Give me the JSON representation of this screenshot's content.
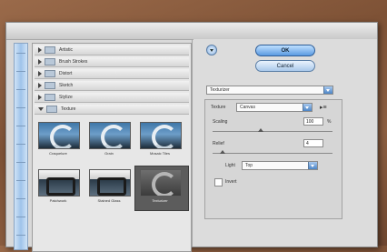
{
  "categories": [
    {
      "label": "Artistic",
      "open": false
    },
    {
      "label": "Brush Strokes",
      "open": false
    },
    {
      "label": "Distort",
      "open": false
    },
    {
      "label": "Sketch",
      "open": false
    },
    {
      "label": "Stylize",
      "open": false
    },
    {
      "label": "Texture",
      "open": true
    }
  ],
  "thumbnails": [
    {
      "label": "Craquelure",
      "style": "blue"
    },
    {
      "label": "Grain",
      "style": "blue"
    },
    {
      "label": "Mosaic Tiles",
      "style": "blue"
    },
    {
      "label": "Patchwork",
      "style": "txt"
    },
    {
      "label": "Stained Glass",
      "style": "txt"
    },
    {
      "label": "Texturizer",
      "style": "dark",
      "selected": true
    }
  ],
  "buttons": {
    "ok": "OK",
    "cancel": "Cancel"
  },
  "filter_select": "Texturizer",
  "texture": {
    "label": "Texture",
    "value": "Canvas"
  },
  "scaling": {
    "label": "Scaling",
    "value": "100",
    "unit": "%",
    "level": 0.4
  },
  "relief": {
    "label": "Relief",
    "value": "4",
    "level": 0.08
  },
  "light": {
    "label": "Light",
    "value": "Top"
  },
  "invert": {
    "label": "Invert",
    "checked": false
  },
  "colors": {
    "accent": "#5a9ae2",
    "panel": "#d9d9d9",
    "background": "#8d5f41"
  }
}
